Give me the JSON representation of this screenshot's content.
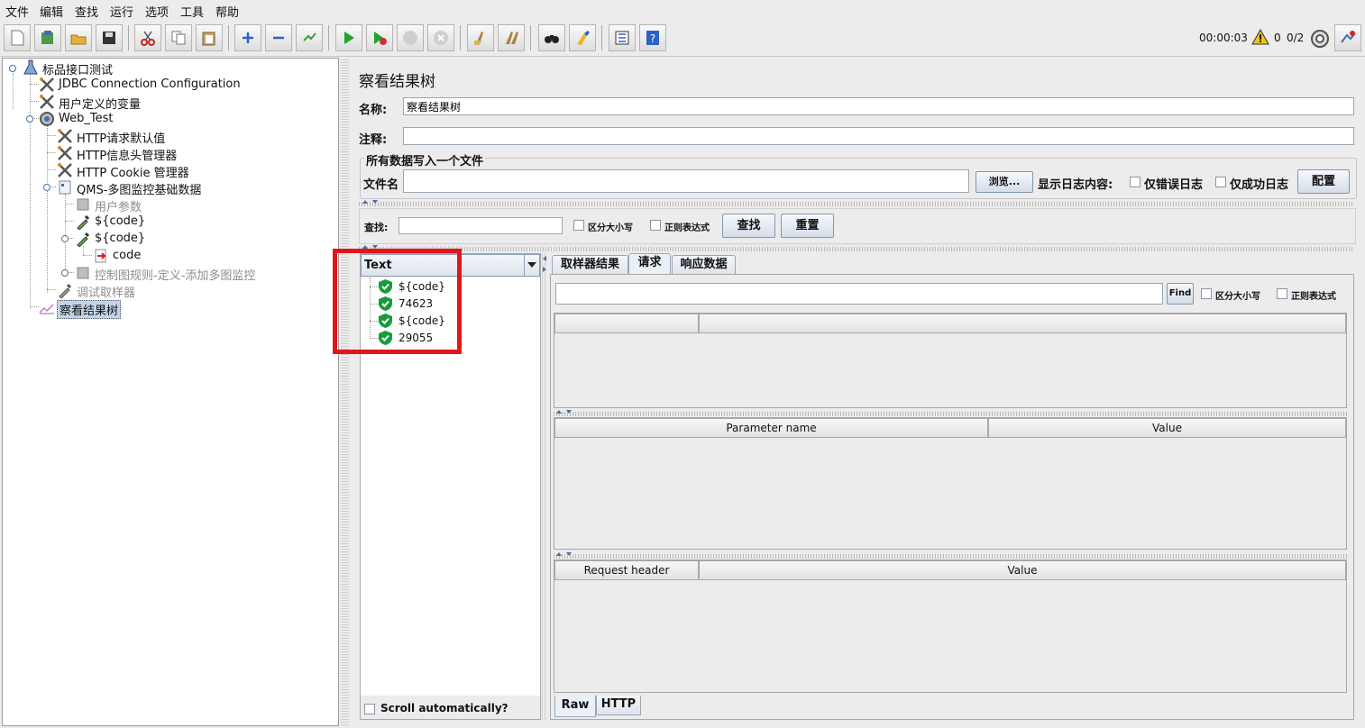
{
  "menu": [
    "文件",
    "编辑",
    "查找",
    "运行",
    "选项",
    "工具",
    "帮助"
  ],
  "toolbar": {
    "icons": [
      "new-icon",
      "templates-icon",
      "open-icon",
      "save-icon",
      "cut-icon",
      "copy-icon",
      "paste-icon",
      "expand-icon",
      "collapse-icon",
      "toggle-icon",
      "start-icon",
      "start-no-pause-icon",
      "stop-icon",
      "shutdown-icon",
      "clear-icon",
      "clear-all-icon",
      "search-icon",
      "reset-search-icon",
      "function-helper-icon",
      "help-icon"
    ],
    "timer": "00:00:03",
    "warning_count": "0",
    "threads": "0/2"
  },
  "tree": {
    "root": "标品接口测试",
    "jdbc": "JDBC Connection Configuration",
    "user_vars": "用户定义的变量",
    "thread_group": "Web_Test",
    "http_defaults": "HTTP请求默认值",
    "header_manager": "HTTP信息头管理器",
    "cookie_manager": "HTTP Cookie 管理器",
    "qms": "QMS-多图监控基础数据",
    "user_params": "用户参数",
    "code1": "${code}",
    "code2": "${code}",
    "code_leaf": "code",
    "controller": "控制图规则-定义-添加多图监控",
    "debug_sampler": "调试取样器",
    "result_tree": "察看结果树"
  },
  "right": {
    "title": "察看结果树",
    "name_label": "名称:",
    "name_value": "察看结果树",
    "comment_label": "注释:",
    "comment_value": "",
    "file_section": "所有数据写入一个文件",
    "filename_label": "文件名",
    "filename_value": "",
    "browse_button": "浏览...",
    "log_label": "显示日志内容:",
    "errors_only": "仅错误日志",
    "success_only": "仅成功日志",
    "configure_button": "配置",
    "search_label": "查找:",
    "search_value": "",
    "case_sensitive": "区分大小写",
    "regex": "正则表达式",
    "search_button": "查找",
    "reset_button": "重置"
  },
  "results": {
    "renderer": "Text",
    "items": [
      "${code}",
      "74623",
      "${code}",
      "29055"
    ],
    "scroll_auto": "Scroll automatically?"
  },
  "detail": {
    "tabs": [
      "取样器结果",
      "请求",
      "响应数据"
    ],
    "active_tab": "请求",
    "find_button": "Find",
    "case_sensitive": "区分大小写",
    "regex": "正则表达式",
    "param_headers": [
      "Parameter name",
      "Value"
    ],
    "req_headers": [
      "Request header",
      "Value"
    ],
    "bottom_tabs": [
      "Raw",
      "HTTP"
    ]
  },
  "colors": {
    "highlight": "#e0161a",
    "selection": "#c3d4ea",
    "success": "#1a9b3a"
  }
}
